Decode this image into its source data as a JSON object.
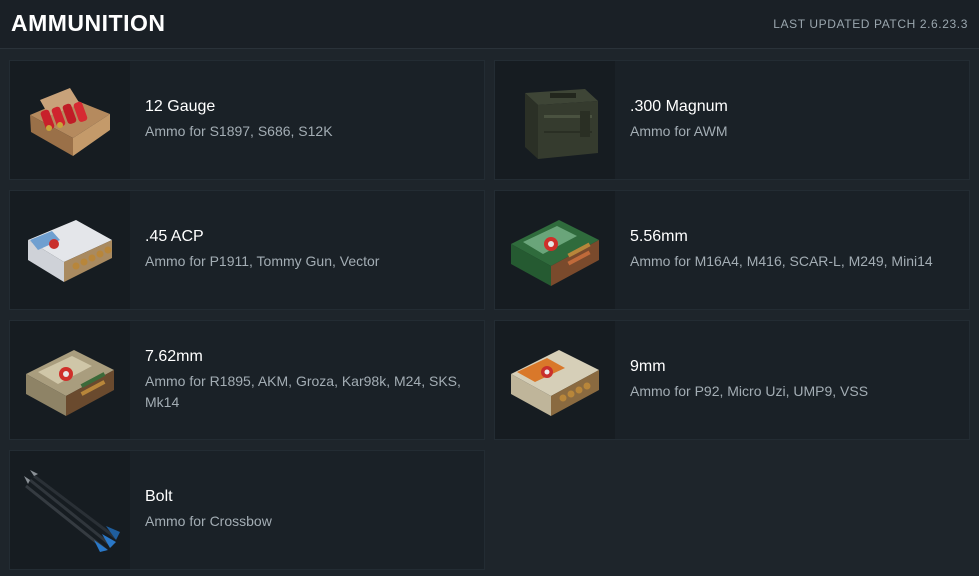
{
  "header": {
    "title": "AMMUNITION",
    "patch": "LAST UPDATED PATCH 2.6.23.3"
  },
  "items": [
    {
      "name": "12 Gauge",
      "desc": "Ammo for S1897, S686, S12K",
      "icon": "shotgun-shells-box-icon"
    },
    {
      "name": ".300 Magnum",
      "desc": "Ammo for AWM",
      "icon": "ammo-can-icon"
    },
    {
      "name": ".45 ACP",
      "desc": "Ammo for P1911, Tommy Gun, Vector",
      "icon": "pistol-ammo-box-icon"
    },
    {
      "name": "5.56mm",
      "desc": "Ammo for M16A4, M416, SCAR-L, M249, Mini14",
      "icon": "rifle-ammo-box-green-icon"
    },
    {
      "name": "7.62mm",
      "desc": "Ammo for R1895, AKM, Groza, Kar98k, M24, SKS, Mk14",
      "icon": "rifle-ammo-box-tan-icon"
    },
    {
      "name": "9mm",
      "desc": "Ammo for P92, Micro Uzi, UMP9, VSS",
      "icon": "pistol-ammo-box-orange-icon"
    },
    {
      "name": "Bolt",
      "desc": "Ammo for Crossbow",
      "icon": "crossbow-bolts-icon"
    }
  ]
}
